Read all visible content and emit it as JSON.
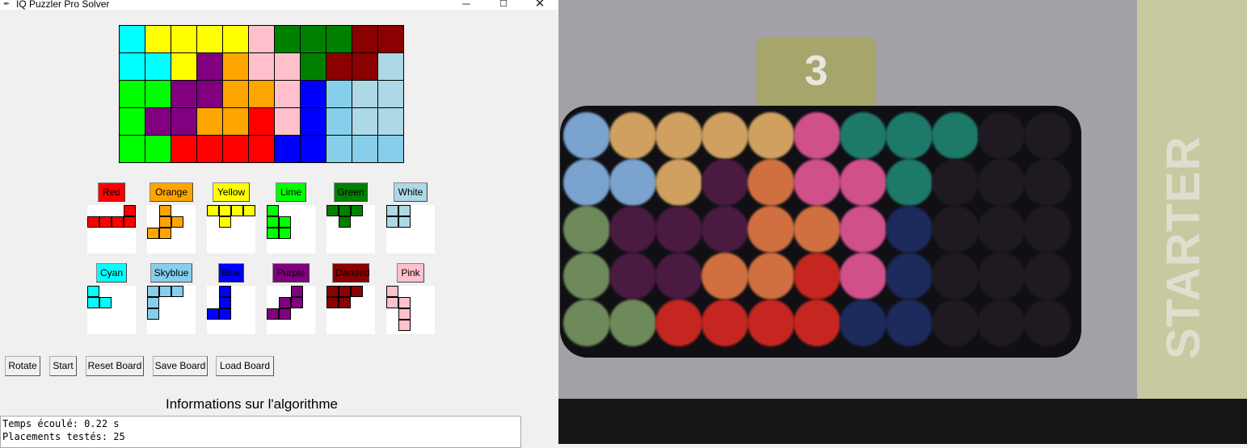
{
  "window": {
    "title": "IQ Puzzler Pro Solver",
    "controls": {
      "minimize": "─",
      "maximize": "☐",
      "close": "✕"
    }
  },
  "colors": {
    "red": "#ff0000",
    "orange": "#ffa500",
    "yellow": "#ffff00",
    "lime": "#00ff00",
    "green": "#008000",
    "white": "#add8e6",
    "cyan": "#00ffff",
    "skyblue": "#87ceeb",
    "blue": "#0000ff",
    "purple": "#800080",
    "darkred": "#8b0000",
    "pink": "#ffc0cb"
  },
  "board": {
    "rows": [
      [
        "cyan",
        "yellow",
        "yellow",
        "yellow",
        "yellow",
        "pink",
        "green",
        "green",
        "green",
        "darkred",
        "darkred"
      ],
      [
        "cyan",
        "cyan",
        "yellow",
        "purple",
        "orange",
        "pink",
        "pink",
        "green",
        "darkred",
        "darkred",
        "white"
      ],
      [
        "lime",
        "lime",
        "purple",
        "purple",
        "orange",
        "orange",
        "pink",
        "blue",
        "skyblue",
        "white",
        "white"
      ],
      [
        "lime",
        "purple",
        "purple",
        "orange",
        "orange",
        "red",
        "pink",
        "blue",
        "skyblue",
        "white",
        "white"
      ],
      [
        "lime",
        "lime",
        "red",
        "red",
        "red",
        "red",
        "blue",
        "blue",
        "skyblue",
        "skyblue",
        "skyblue"
      ]
    ]
  },
  "pieces": [
    {
      "label": "Red",
      "color": "red",
      "shape": [
        [
          0,
          3
        ],
        [
          1,
          0
        ],
        [
          1,
          1
        ],
        [
          1,
          2
        ],
        [
          1,
          3
        ]
      ]
    },
    {
      "label": "Orange",
      "color": "orange",
      "shape": [
        [
          0,
          1
        ],
        [
          1,
          1
        ],
        [
          1,
          2
        ],
        [
          2,
          0
        ],
        [
          2,
          1
        ]
      ]
    },
    {
      "label": "Yellow",
      "color": "yellow",
      "shape": [
        [
          0,
          0
        ],
        [
          0,
          1
        ],
        [
          0,
          2
        ],
        [
          0,
          3
        ],
        [
          1,
          1
        ]
      ]
    },
    {
      "label": "Lime",
      "color": "lime",
      "shape": [
        [
          0,
          0
        ],
        [
          1,
          0
        ],
        [
          1,
          1
        ],
        [
          2,
          0
        ],
        [
          2,
          1
        ]
      ]
    },
    {
      "label": "Green",
      "color": "green",
      "shape": [
        [
          0,
          0
        ],
        [
          0,
          1
        ],
        [
          0,
          2
        ],
        [
          1,
          1
        ]
      ]
    },
    {
      "label": "White",
      "color": "white",
      "shape": [
        [
          0,
          0
        ],
        [
          0,
          1
        ],
        [
          1,
          0
        ],
        [
          1,
          1
        ]
      ]
    },
    {
      "label": "Cyan",
      "color": "cyan",
      "shape": [
        [
          0,
          0
        ],
        [
          1,
          0
        ],
        [
          1,
          1
        ]
      ]
    },
    {
      "label": "Skyblue",
      "color": "skyblue",
      "shape": [
        [
          0,
          0
        ],
        [
          0,
          1
        ],
        [
          0,
          2
        ],
        [
          1,
          0
        ],
        [
          2,
          0
        ]
      ]
    },
    {
      "label": "Blue",
      "color": "blue",
      "shape": [
        [
          0,
          1
        ],
        [
          1,
          1
        ],
        [
          2,
          0
        ],
        [
          2,
          1
        ]
      ]
    },
    {
      "label": "Purple",
      "color": "purple",
      "shape": [
        [
          0,
          2
        ],
        [
          1,
          1
        ],
        [
          1,
          2
        ],
        [
          2,
          0
        ],
        [
          2,
          1
        ]
      ]
    },
    {
      "label": "Darkred",
      "color": "darkred",
      "shape": [
        [
          0,
          0
        ],
        [
          0,
          1
        ],
        [
          0,
          2
        ],
        [
          1,
          0
        ],
        [
          1,
          1
        ]
      ]
    },
    {
      "label": "Pink",
      "color": "pink",
      "shape": [
        [
          0,
          0
        ],
        [
          1,
          0
        ],
        [
          1,
          1
        ],
        [
          2,
          1
        ],
        [
          3,
          1
        ]
      ]
    }
  ],
  "actions": {
    "rotate": "Rotate",
    "start": "Start",
    "reset": "Reset Board",
    "save": "Save Board",
    "load": "Load Board"
  },
  "info": {
    "title": "Informations sur l'algorithme",
    "elapsed": "Temps écoulé: 0.22 s",
    "placements": "Placements testés: 25"
  },
  "camera": {
    "level": "3",
    "side_text": "STARTER",
    "peg_colors": {
      "B": "#7aa3cf",
      "O": "#cfa060",
      "T": "#1d7a68",
      "P": "#d0508a",
      "D": "#4a1a40",
      "R": "#c5261f",
      "N": "#1c2a5c",
      "G": "#6e8a5a",
      "C": "#d07040",
      "E": "#1f1a22"
    },
    "pegs": [
      "BOOOOPTTTEE",
      "BBODCPPTEEE",
      "GDDDCCPNEEE",
      "GDDCCRPNEEE",
      "GGRRRRNNEEE"
    ]
  }
}
